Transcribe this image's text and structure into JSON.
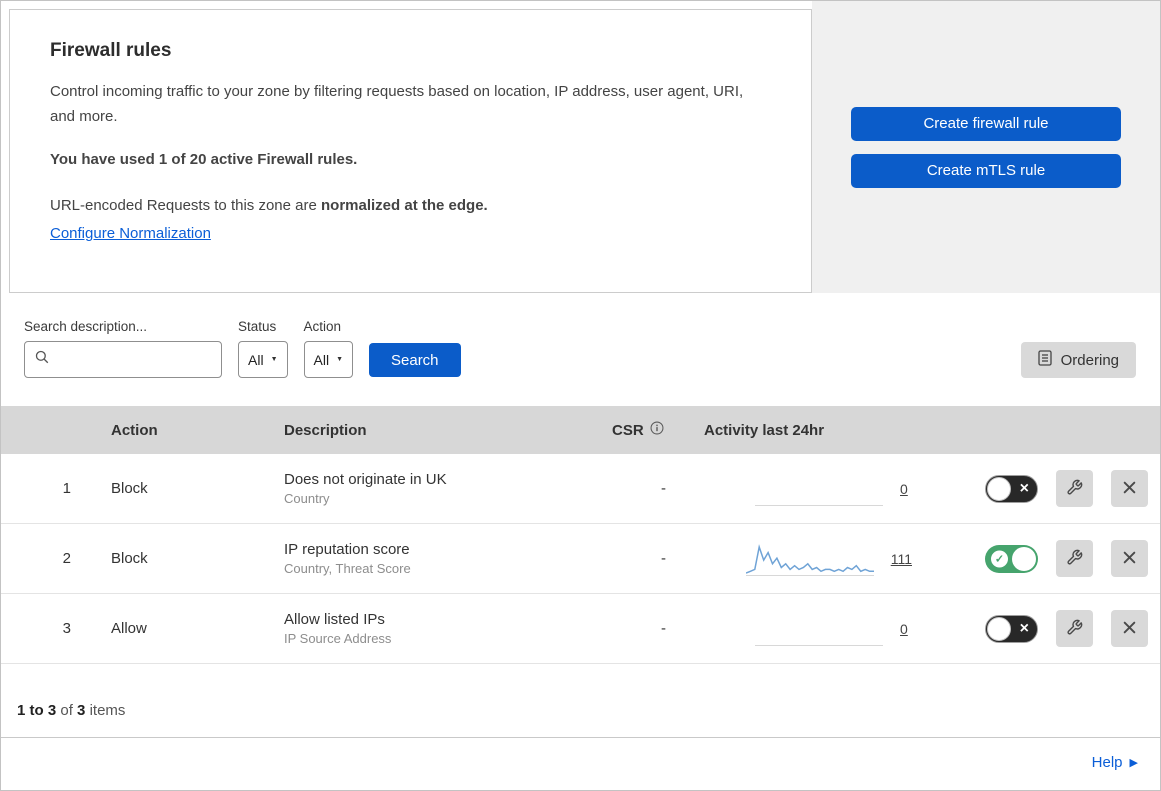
{
  "overview": {
    "title": "Firewall rules",
    "description": "Control incoming traffic to your zone by filtering requests based on location, IP address, user agent, URI, and more.",
    "usage": "You have used 1 of 20 active Firewall rules.",
    "normalization_text": "URL-encoded Requests to this zone are",
    "normalization_bold": "normalized at the edge.",
    "normalization_link": "Configure Normalization"
  },
  "buttons": {
    "create_firewall_rule": "Create firewall rule",
    "create_mtls_rule": "Create mTLS rule"
  },
  "filters": {
    "search_label": "Search description...",
    "status_label": "Status",
    "status_value": "All",
    "action_label": "Action",
    "action_value": "All",
    "search_button": "Search",
    "ordering_button": "Ordering"
  },
  "table": {
    "columns": {
      "action": "Action",
      "description": "Description",
      "csr": "CSR",
      "activity": "Activity last 24hr"
    },
    "rows": [
      {
        "index": "1",
        "action": "Block",
        "description": "Does not originate in UK",
        "description_sub": "Country",
        "csr": "-",
        "activity_count": "0",
        "enabled": false,
        "sparkline": []
      },
      {
        "index": "2",
        "action": "Block",
        "description": "IP reputation score",
        "description_sub": "Country, Threat Score",
        "csr": "-",
        "activity_count": "111",
        "enabled": true,
        "sparkline": [
          1,
          2,
          3,
          15,
          8,
          12,
          6,
          9,
          4,
          6,
          3,
          5,
          3,
          4,
          6,
          3,
          4,
          2,
          3,
          3,
          2,
          3,
          2,
          4,
          3,
          5,
          2,
          3,
          2,
          2
        ]
      },
      {
        "index": "3",
        "action": "Allow",
        "description": "Allow listed IPs",
        "description_sub": "IP Source Address",
        "csr": "-",
        "activity_count": "0",
        "enabled": false,
        "sparkline": []
      }
    ]
  },
  "footer": {
    "range": "1 to 3",
    "of": "of",
    "total": "3",
    "items_word": "items"
  },
  "help": {
    "label": "Help"
  },
  "icons": {
    "caret_down": "▼",
    "toggle_on_check": "✓",
    "toggle_off_x": "×",
    "help_arrow": "▶"
  },
  "colors": {
    "primary_blue": "#0b5cc9",
    "link_blue": "#0b5ed7",
    "toggle_green": "#46a46d",
    "toggle_off_dark": "#282828",
    "sparkline_blue": "#6fa3d6",
    "table_header_gray": "#d7d7d7",
    "panel_gray": "#f0f0f0",
    "icon_button_gray": "#d9d9d9"
  }
}
